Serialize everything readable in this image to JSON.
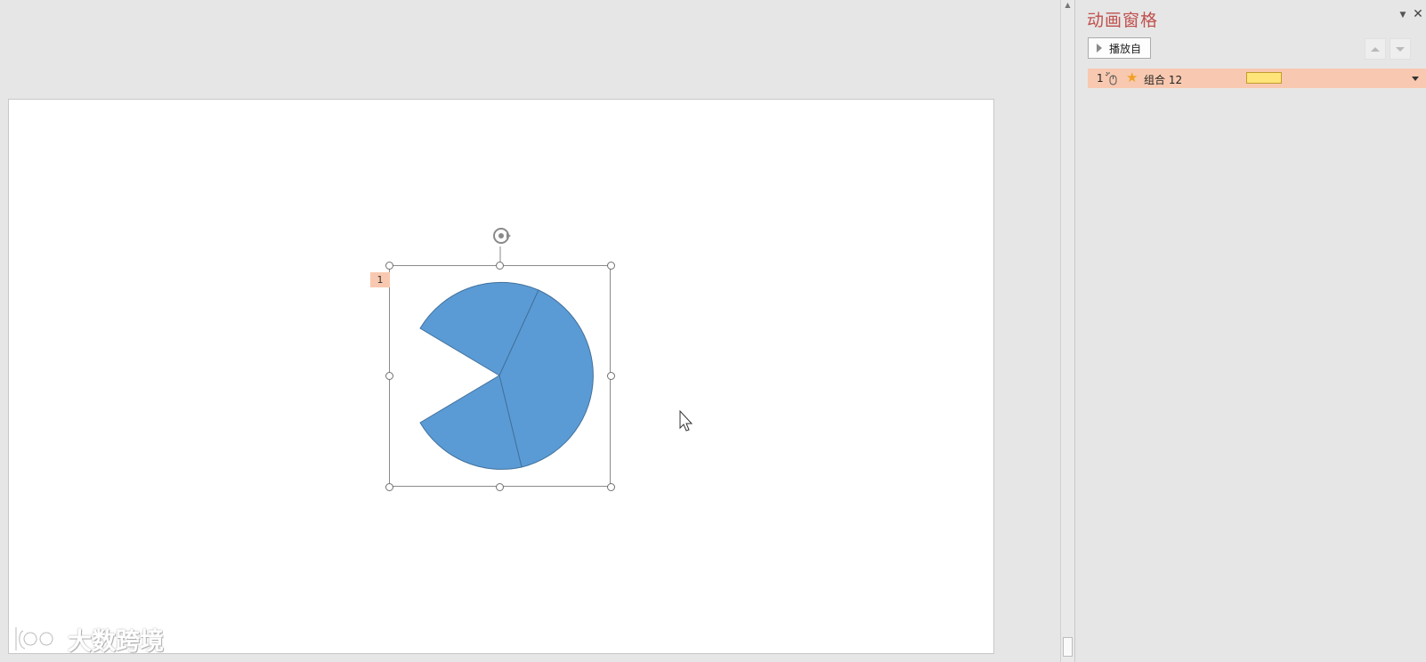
{
  "pane": {
    "title": "动画窗格",
    "play_from_label": "播放自",
    "items": [
      {
        "number": "1",
        "trigger_icon": "mouse-click-icon",
        "effect_icon": "star-icon",
        "name": "组合 12"
      }
    ]
  },
  "slide": {
    "animation_tag": "1",
    "shape_fill_color": "#5b9bd5",
    "shape_stroke_color": "#41719c",
    "animation_tag_color": "#f8c9b0",
    "timing_bar_color": "#ffe47a"
  },
  "watermark": {
    "text": "大数跨境"
  },
  "colors": {
    "pane_title": "#c0504d",
    "selected_item_bg": "#f8c9b0"
  }
}
